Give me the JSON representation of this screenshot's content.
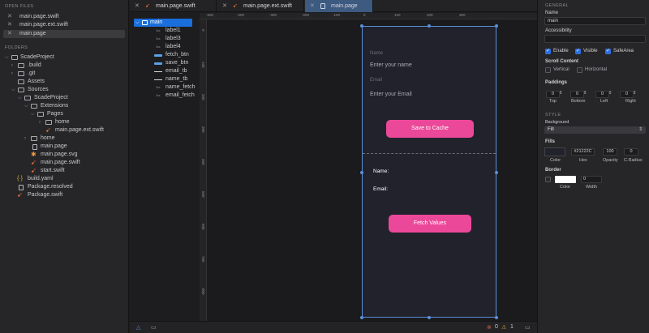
{
  "left": {
    "open_files_title": "OPEN FILES",
    "open_files": [
      "main.page.swift",
      "main.page.ext.swift",
      "main.page"
    ],
    "folders_title": "FOLDERS",
    "tree": [
      {
        "label": "ScadeProject"
      },
      {
        "label": ".build"
      },
      {
        "label": ".git"
      },
      {
        "label": "Assets"
      },
      {
        "label": "Sources"
      },
      {
        "label": "ScadeProject"
      },
      {
        "label": "Extensions"
      },
      {
        "label": "Pages"
      },
      {
        "label": "home"
      },
      {
        "label": "main.page.ext.swift"
      },
      {
        "label": "home"
      },
      {
        "label": "main.page"
      },
      {
        "label": "main.page.svg"
      },
      {
        "label": "main.page.swift"
      },
      {
        "label": "start.swift"
      },
      {
        "label": "build.yaml"
      },
      {
        "label": "Package.resolved"
      },
      {
        "label": "Package.swift"
      }
    ]
  },
  "tabs": [
    "main.page.swift",
    "main.page.ext.swift",
    "main.page"
  ],
  "hierarchy": [
    "main",
    "label1",
    "label3",
    "label4",
    "fetch_btn",
    "save_btn",
    "email_tb",
    "name_tb",
    "name_fetch",
    "email_fetch"
  ],
  "hierarchy_type": "3ss",
  "ruler": {
    "h": [
      "-500",
      "-400",
      "-300",
      "-200",
      "-100",
      "0",
      "100",
      "200",
      "300"
    ],
    "v": [
      "0",
      "100",
      "200",
      "300",
      "400",
      "500",
      "600",
      "700",
      "800"
    ]
  },
  "phone": {
    "name_label": "Name",
    "name_placeholder": "Enter your name",
    "email_label": "Email",
    "email_placeholder": "Enter your Email",
    "save_button": "Save to Cache",
    "name_out": "Name:",
    "email_out": "Email:",
    "fetch_button": "Fetch Values",
    "bg_color": "#21222C",
    "btn_color": "#ec4899"
  },
  "bottom": {
    "errors": "0",
    "warnings": "1"
  },
  "inspector": {
    "general": "GENERAL",
    "name_label": "Name",
    "name_value": "main",
    "accessibility_label": "Accessibility",
    "enable": "Enable",
    "visible": "Visible",
    "safearea": "SafeArea",
    "scroll_content": "Scroll Content",
    "vertical": "Vertical",
    "horizontal": "Horizontal",
    "paddings": "Paddings",
    "pad_values": [
      "0",
      "0",
      "0",
      "0"
    ],
    "pad_labels": [
      "Top",
      "Bottom",
      "Left",
      "Right"
    ],
    "style": "STYLE",
    "background": "Background",
    "fill": "Fill",
    "fills": "Fills",
    "hex": "#21222C",
    "opacity": "100",
    "radius": "0",
    "fill_labels": [
      "Color",
      "Hex",
      "Opacity",
      "C.Radius"
    ],
    "border": "Border",
    "border_width": "0",
    "border_labels": [
      "Color",
      "Width"
    ]
  }
}
